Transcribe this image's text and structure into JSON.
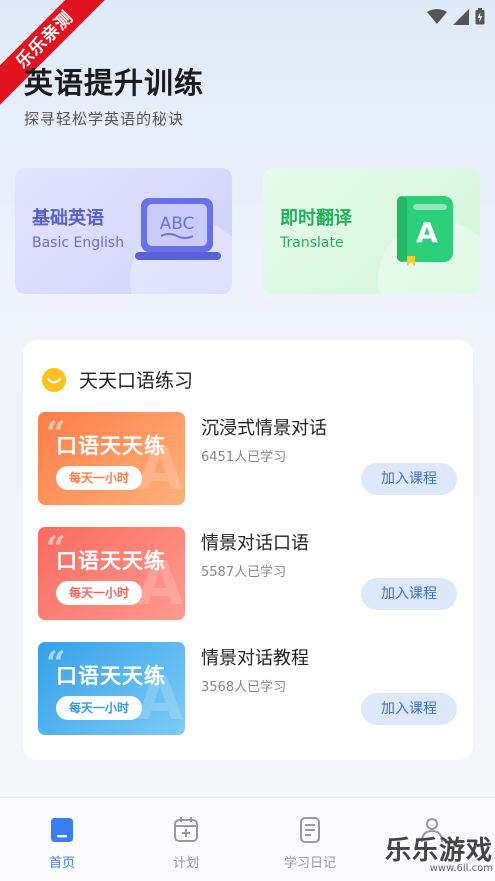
{
  "overlay": {
    "ribbon_text": "乐乐亲测"
  },
  "header": {
    "title": "英语提升训练",
    "subtitle": "探寻轻松学英语的秘诀"
  },
  "feature_cards": [
    {
      "title": "基础英语",
      "subtitle": "Basic English",
      "icon": "laptop-abc-icon",
      "icon_text": "ABC",
      "color": "#5a5fcf"
    },
    {
      "title": "即时翻译",
      "subtitle": "Translate",
      "icon": "book-a-icon",
      "icon_text": "A",
      "color": "#23b05b"
    }
  ],
  "section": {
    "title": "天天口语练习",
    "icon": "smile-icon",
    "courses": [
      {
        "thumb_title": "口语天天练",
        "thumb_pill": "每天一小时",
        "name": "沉浸式情景对话",
        "count": "6451人已学习",
        "button": "加入课程",
        "color": "#ff7d48"
      },
      {
        "thumb_title": "口语天天练",
        "thumb_pill": "每天一小时",
        "name": "情景对话口语",
        "count": "5587人已学习",
        "button": "加入课程",
        "color": "#fa6a5f"
      },
      {
        "thumb_title": "口语天天练",
        "thumb_pill": "每天一小时",
        "name": "情景对话教程",
        "count": "3568人已学习",
        "button": "加入课程",
        "color": "#35a1e8"
      }
    ]
  },
  "tabbar": {
    "items": [
      {
        "label": "首页",
        "icon": "home-icon",
        "active": true
      },
      {
        "label": "计划",
        "icon": "calendar-plus-icon",
        "active": false
      },
      {
        "label": "学习日记",
        "icon": "diary-icon",
        "active": false
      },
      {
        "label": "",
        "icon": "person-icon",
        "active": false
      }
    ]
  },
  "watermark": {
    "text": "乐乐游戏",
    "url": "www.6ll.com"
  },
  "colors": {
    "accent": "#3a7cf2",
    "join_button_bg": "#dde9fb"
  }
}
